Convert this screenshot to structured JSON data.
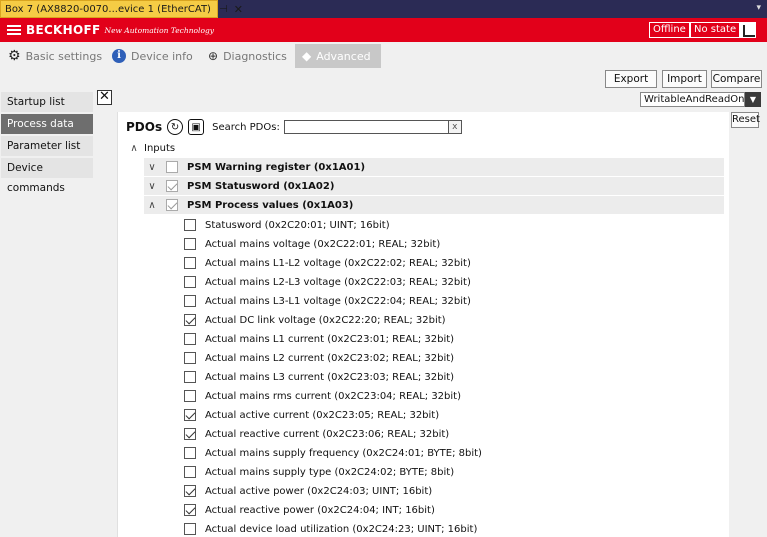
{
  "doc_tab": {
    "title": "Box 7 (AX8820-0070...evice 1 (EtherCAT)",
    "pin": "⊣",
    "close": "✕"
  },
  "header": {
    "brand": "BECKHOFF",
    "tagline": "New Automation Technology",
    "badge_offline": "Offline",
    "badge_state": "No state"
  },
  "tabs": [
    {
      "label": "Basic settings",
      "icon": "gear-icon"
    },
    {
      "label": "Device info",
      "icon": "info-icon"
    },
    {
      "label": "Diagnostics",
      "icon": "diagnostics-icon"
    },
    {
      "label": "Advanced",
      "icon": "graduation-cap-icon"
    }
  ],
  "toolbar": {
    "export": "Export",
    "import": "Import",
    "compare": "Compare",
    "filter_value": "WritableAndReadOnly"
  },
  "sidebar": {
    "items": [
      {
        "label": "Startup list"
      },
      {
        "label": "Process data"
      },
      {
        "label": "Parameter list"
      },
      {
        "label": "Device commands"
      }
    ]
  },
  "pdo": {
    "label": "PDOs",
    "search_label": "Search PDOs:",
    "search_value": "",
    "clear": "x",
    "reset": "Reset",
    "inputs_label": "Inputs",
    "groups": [
      {
        "label": "PSM Warning register (0x1A01)",
        "checked": false,
        "expanded": false
      },
      {
        "label": "PSM Statusword (0x1A02)",
        "checked": true,
        "expanded": false
      },
      {
        "label": "PSM Process values (0x1A03)",
        "checked": true,
        "expanded": true
      }
    ],
    "entries": [
      {
        "label": "Statusword (0x2C20:01; UINT; 16bit)",
        "checked": false
      },
      {
        "label": "Actual mains voltage (0x2C22:01; REAL; 32bit)",
        "checked": false
      },
      {
        "label": "Actual mains L1-L2 voltage (0x2C22:02; REAL; 32bit)",
        "checked": false
      },
      {
        "label": "Actual mains L2-L3 voltage (0x2C22:03; REAL; 32bit)",
        "checked": false
      },
      {
        "label": "Actual mains L3-L1 voltage (0x2C22:04; REAL; 32bit)",
        "checked": false
      },
      {
        "label": "Actual DC link voltage (0x2C22:20; REAL; 32bit)",
        "checked": true
      },
      {
        "label": "Actual mains L1 current (0x2C23:01; REAL; 32bit)",
        "checked": false
      },
      {
        "label": "Actual mains L2 current (0x2C23:02; REAL; 32bit)",
        "checked": false
      },
      {
        "label": "Actual mains L3 current (0x2C23:03; REAL; 32bit)",
        "checked": false
      },
      {
        "label": "Actual mains rms current (0x2C23:04; REAL; 32bit)",
        "checked": false
      },
      {
        "label": "Actual active current (0x2C23:05; REAL; 32bit)",
        "checked": true
      },
      {
        "label": "Actual reactive current (0x2C23:06; REAL; 32bit)",
        "checked": true
      },
      {
        "label": "Actual mains supply frequency (0x2C24:01; BYTE; 8bit)",
        "checked": false
      },
      {
        "label": "Actual mains supply type (0x2C24:02; BYTE; 8bit)",
        "checked": false
      },
      {
        "label": "Actual active power (0x2C24:03; UINT; 16bit)",
        "checked": true
      },
      {
        "label": "Actual reactive power (0x2C24:04; INT; 16bit)",
        "checked": true
      },
      {
        "label": "Actual device load utilization (0x2C24:23; UINT; 16bit)",
        "checked": false
      }
    ]
  },
  "colors": {
    "brand_red": "#e2001a",
    "tab_yellow": "#f5cc45",
    "active_sidebar": "#6e6e6e"
  }
}
